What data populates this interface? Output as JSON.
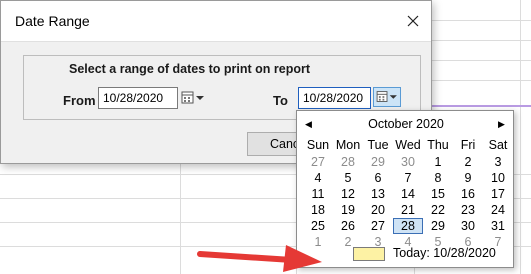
{
  "window": {
    "title": "Date Range"
  },
  "form": {
    "instruction": "Select a range of dates to print on report",
    "from_label": "From",
    "from_value": "10/28/2020",
    "to_label": "To",
    "to_value": "10/28/2020",
    "cancel_label": "Cancel"
  },
  "calendar": {
    "prev_symbol": "◀",
    "next_symbol": "▶",
    "month_label": "October 2020",
    "weekdays": [
      "Sun",
      "Mon",
      "Tue",
      "Wed",
      "Thu",
      "Fri",
      "Sat"
    ],
    "weeks": [
      [
        "27",
        "28",
        "29",
        "30",
        "1",
        "2",
        "3"
      ],
      [
        "4",
        "5",
        "6",
        "7",
        "8",
        "9",
        "10"
      ],
      [
        "11",
        "12",
        "13",
        "14",
        "15",
        "16",
        "17"
      ],
      [
        "18",
        "19",
        "20",
        "21",
        "22",
        "23",
        "24"
      ],
      [
        "25",
        "26",
        "27",
        "28",
        "29",
        "30",
        "31"
      ],
      [
        "1",
        "2",
        "3",
        "4",
        "5",
        "6",
        "7"
      ]
    ],
    "selected_day": "28",
    "today_label": "Today: 10/28/2020"
  },
  "colors": {
    "today_swatch": "#fdf2a4",
    "selection_border": "#3b6fb5",
    "arrow": "#e53935"
  }
}
